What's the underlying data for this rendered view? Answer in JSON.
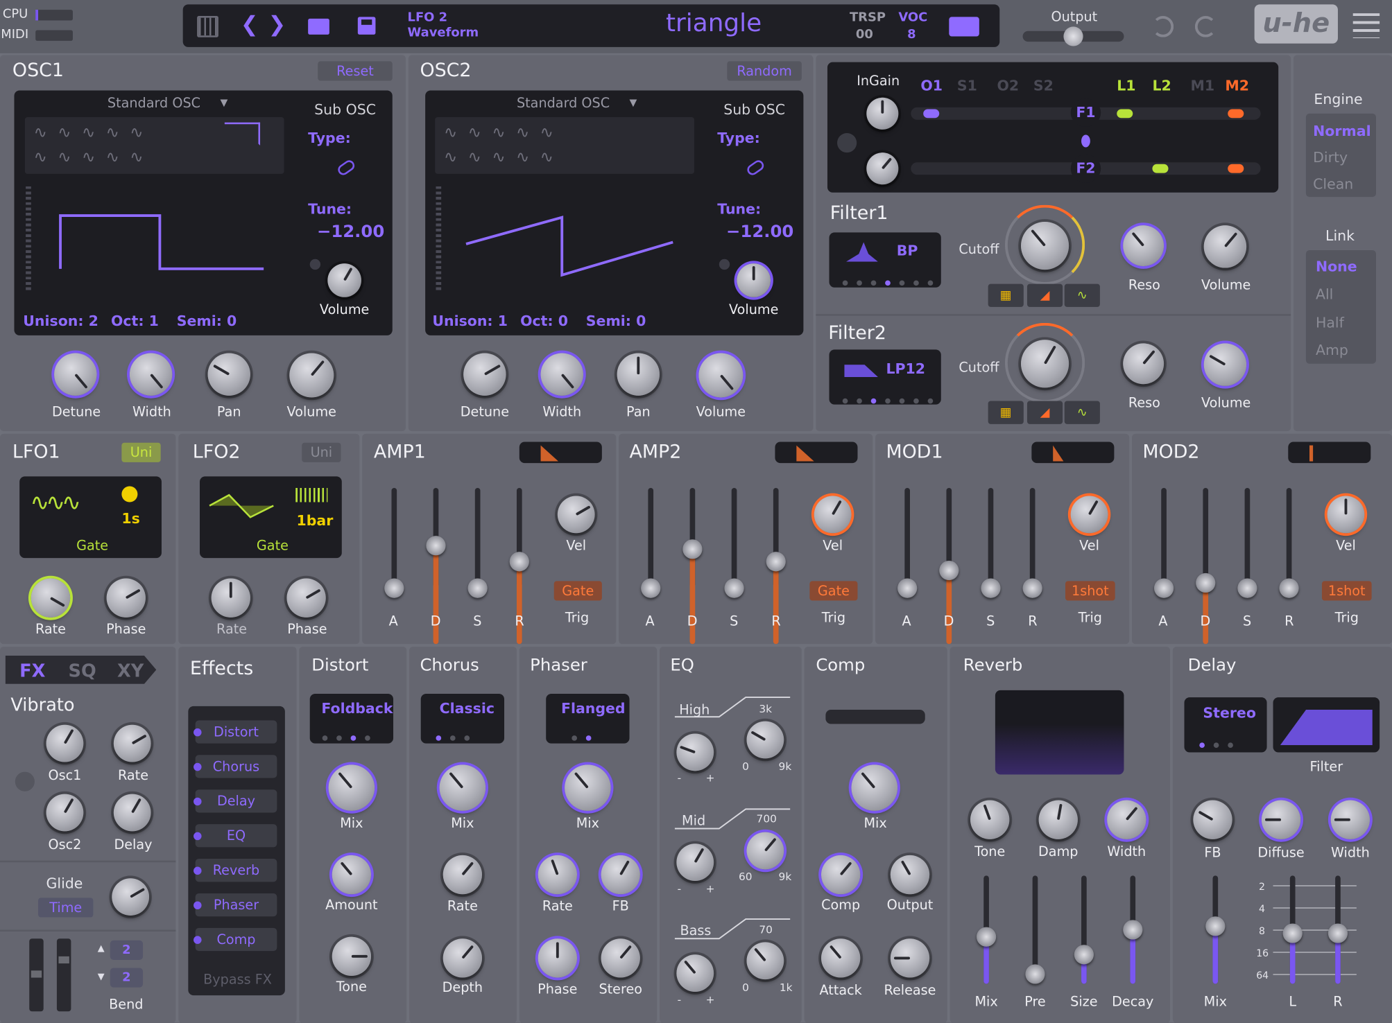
{
  "topbar": {
    "cpu": "CPU",
    "midi": "MIDI",
    "lfo_line1": "LFO 2",
    "lfo_line2": "Waveform",
    "preset_name": "triangle",
    "trsp_label": "TRSP",
    "trsp_value": "00",
    "voc_label": "VOC",
    "voc_value": "8",
    "output_label": "Output",
    "logo": "u-he"
  },
  "osc1": {
    "title": "OSC1",
    "action": "Reset",
    "type": "Standard OSC",
    "sub_title": "Sub OSC",
    "sub_type_label": "Type:",
    "sub_tune_label": "Tune:",
    "sub_tune_value": "−12.00",
    "sub_volume": "Volume",
    "unison_label": "Unison:",
    "unison_value": "2",
    "oct_label": "Oct:",
    "oct_value": "1",
    "semi_label": "Semi:",
    "semi_value": "0",
    "knobs": [
      "Detune",
      "Width",
      "Pan",
      "Volume"
    ]
  },
  "osc2": {
    "title": "OSC2",
    "action": "Random",
    "type": "Standard OSC",
    "sub_title": "Sub OSC",
    "sub_type_label": "Type:",
    "sub_tune_label": "Tune:",
    "sub_tune_value": "−12.00",
    "sub_volume": "Volume",
    "unison_label": "Unison:",
    "unison_value": "1",
    "oct_label": "Oct:",
    "oct_value": "0",
    "semi_label": "Semi:",
    "semi_value": "0",
    "knobs": [
      "Detune",
      "Width",
      "Pan",
      "Volume"
    ]
  },
  "routing": {
    "ingain": "InGain",
    "sources": [
      "O1",
      "S1",
      "O2",
      "S2",
      "L1",
      "L2",
      "M1",
      "M2"
    ],
    "f1": "F1",
    "f2": "F2"
  },
  "filter1": {
    "title": "Filter1",
    "mode": "BP",
    "cutoff": "Cutoff",
    "reso": "Reso",
    "volume": "Volume"
  },
  "filter2": {
    "title": "Filter2",
    "mode": "LP12",
    "cutoff": "Cutoff",
    "reso": "Reso",
    "volume": "Volume"
  },
  "engine": {
    "title": "Engine",
    "options": [
      "Normal",
      "Dirty",
      "Clean"
    ],
    "selected": "Normal"
  },
  "link": {
    "title": "Link",
    "options": [
      "None",
      "All",
      "Half",
      "Amp"
    ],
    "selected": "None"
  },
  "lfo1": {
    "title": "LFO1",
    "mode": "Uni",
    "time": "1s",
    "trigger": "Gate",
    "rate": "Rate",
    "phase": "Phase"
  },
  "lfo2": {
    "title": "LFO2",
    "mode": "Uni",
    "time": "1bar",
    "trigger": "Gate",
    "rate": "Rate",
    "phase": "Phase"
  },
  "env_labels": {
    "a": "A",
    "d": "D",
    "s": "S",
    "r": "R",
    "vel": "Vel",
    "trig": "Trig"
  },
  "amp1": {
    "title": "AMP1",
    "trig": "Gate"
  },
  "amp2": {
    "title": "AMP2",
    "trig": "Gate"
  },
  "mod1": {
    "title": "MOD1",
    "trig": "1shot"
  },
  "mod2": {
    "title": "MOD2",
    "trig": "1shot"
  },
  "modes": [
    "FX",
    "SQ",
    "XY"
  ],
  "vibrato": {
    "title": "Vibrato",
    "osc1": "Osc1",
    "rate": "Rate",
    "osc2": "Osc2",
    "delay": "Delay"
  },
  "glide": {
    "title": "Glide",
    "mode": "Time"
  },
  "bend": {
    "label": "Bend",
    "up": "2",
    "down": "2"
  },
  "effects": {
    "title": "Effects",
    "order": [
      "Distort",
      "Chorus",
      "Delay",
      "EQ",
      "Reverb",
      "Phaser",
      "Comp"
    ],
    "bypass": "Bypass FX"
  },
  "distort": {
    "title": "Distort",
    "type": "Foldback",
    "mix": "Mix",
    "amount": "Amount",
    "tone": "Tone"
  },
  "chorus": {
    "title": "Chorus",
    "type": "Classic",
    "mix": "Mix",
    "rate": "Rate",
    "depth": "Depth"
  },
  "phaser": {
    "title": "Phaser",
    "type": "Flanged",
    "mix": "Mix",
    "rate": "Rate",
    "fb": "FB",
    "phase": "Phase",
    "stereo": "Stereo"
  },
  "eq": {
    "title": "EQ",
    "high": "High",
    "high_freq": "3k",
    "mid": "Mid",
    "mid_freq": "700",
    "bass": "Bass",
    "bass_freq": "70",
    "minus": "-",
    "plus": "+",
    "hmin": "0",
    "hmax": "9k",
    "mmin": "60",
    "mmax": "9k",
    "bmin": "0",
    "bmax": "1k"
  },
  "comp": {
    "title": "Comp",
    "mix": "Mix",
    "comp": "Comp",
    "output": "Output",
    "attack": "Attack",
    "release": "Release"
  },
  "reverb": {
    "title": "Reverb",
    "tone": "Tone",
    "damp": "Damp",
    "width": "Width",
    "mix": "Mix",
    "pre": "Pre",
    "size": "Size",
    "decay": "Decay"
  },
  "delay": {
    "title": "Delay",
    "type": "Stereo",
    "filter": "Filter",
    "fb": "FB",
    "diffuse": "Diffuse",
    "width": "Width",
    "mix": "Mix",
    "l": "L",
    "r": "R",
    "scale": [
      "2",
      "4",
      "8",
      "16",
      "64"
    ]
  }
}
